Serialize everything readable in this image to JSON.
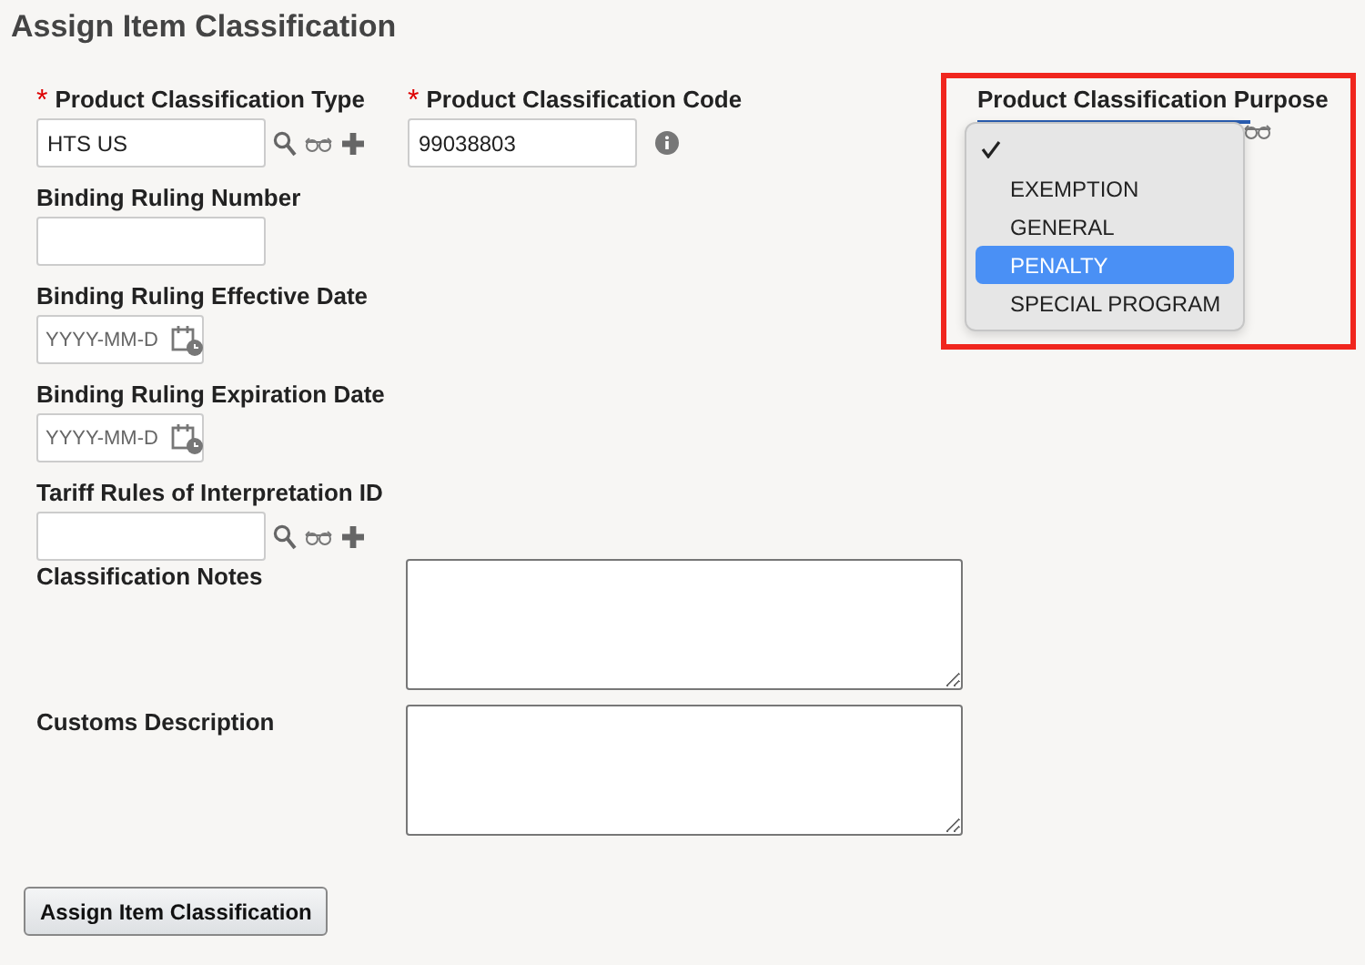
{
  "title": "Assign Item Classification",
  "required_marker": "*",
  "top_fields": [
    {
      "kind": "lookup",
      "label": "Product Classification Type",
      "required": true,
      "value": "HTS US"
    },
    {
      "kind": "info",
      "label": "Product Classification Code",
      "required": true,
      "value": "99038803"
    }
  ],
  "purpose": {
    "label": "Product Classification Purpose",
    "highlighted": true,
    "options": [
      {
        "checked": true,
        "selected": false
      },
      {
        "label": "EXEMPTION",
        "checked": false,
        "selected": false
      },
      {
        "label": "GENERAL",
        "checked": false,
        "selected": false
      },
      {
        "label": "PENALTY",
        "checked": false,
        "selected": true
      },
      {
        "label": "SPECIAL PROGRAM",
        "checked": false,
        "selected": false
      }
    ]
  },
  "fields": [
    {
      "kind": "text",
      "label": "Binding Ruling Number",
      "required": false
    },
    {
      "kind": "date",
      "label": "Binding Ruling Effective Date",
      "required": false,
      "placeholder": "YYYY-MM-D"
    },
    {
      "kind": "date",
      "label": "Binding Ruling Expiration Date",
      "required": false,
      "placeholder": "YYYY-MM-D"
    },
    {
      "kind": "lookup",
      "label": "Tariff Rules of Interpretation ID",
      "required": false
    }
  ],
  "text_areas": [
    {
      "label": "Classification Notes"
    },
    {
      "label": "Customs Description"
    }
  ],
  "submit": "Assign Item Classification"
}
